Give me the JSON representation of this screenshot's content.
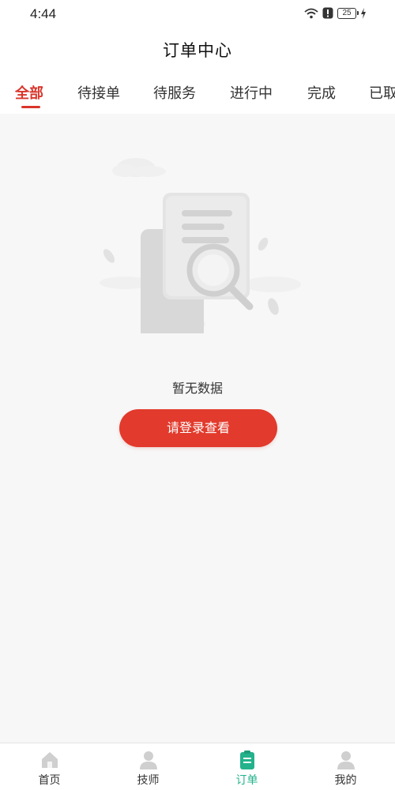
{
  "status_bar": {
    "time": "4:44",
    "battery": "25",
    "icons": [
      "wifi-icon",
      "alert-icon",
      "battery-icon",
      "charging-icon"
    ]
  },
  "header": {
    "title": "订单中心"
  },
  "tabs": [
    {
      "label": "全部",
      "active": true
    },
    {
      "label": "待接单",
      "active": false
    },
    {
      "label": "待服务",
      "active": false
    },
    {
      "label": "进行中",
      "active": false
    },
    {
      "label": "完成",
      "active": false
    },
    {
      "label": "已取消",
      "active": false
    }
  ],
  "empty_state": {
    "icon": "document-search-icon",
    "message": "暂无数据",
    "button_label": "请登录查看"
  },
  "bottom_nav": [
    {
      "label": "首页",
      "icon": "home-icon",
      "active": false
    },
    {
      "label": "技师",
      "icon": "technician-icon",
      "active": false
    },
    {
      "label": "订单",
      "icon": "order-icon",
      "active": true
    },
    {
      "label": "我的",
      "icon": "profile-icon",
      "active": false
    }
  ],
  "colors": {
    "accent": "#d9352b",
    "button": "#e23a2c",
    "nav_active": "#23b28c",
    "content_bg": "#f7f7f7"
  }
}
